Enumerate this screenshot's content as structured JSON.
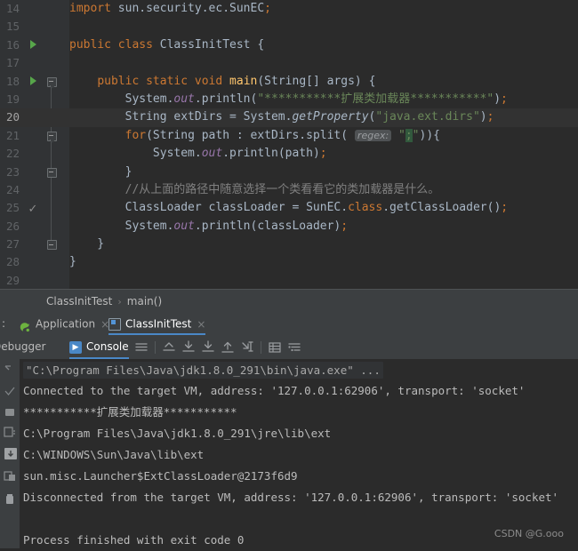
{
  "editor": {
    "name": "code-editor",
    "lines": [
      {
        "n": "14",
        "marker": "",
        "fold": "",
        "cur": false
      },
      {
        "n": "15",
        "marker": "",
        "fold": "",
        "cur": false
      },
      {
        "n": "16",
        "marker": "run",
        "fold": "",
        "cur": false
      },
      {
        "n": "17",
        "marker": "",
        "fold": "",
        "cur": false
      },
      {
        "n": "18",
        "marker": "run",
        "fold": "minus",
        "cur": false
      },
      {
        "n": "19",
        "marker": "",
        "fold": "",
        "cur": false
      },
      {
        "n": "20",
        "marker": "",
        "fold": "",
        "cur": true
      },
      {
        "n": "21",
        "marker": "",
        "fold": "minus",
        "cur": false
      },
      {
        "n": "22",
        "marker": "",
        "fold": "",
        "cur": false
      },
      {
        "n": "23",
        "marker": "",
        "fold": "end",
        "cur": false
      },
      {
        "n": "24",
        "marker": "",
        "fold": "",
        "cur": false
      },
      {
        "n": "25",
        "marker": "check",
        "fold": "",
        "cur": false
      },
      {
        "n": "26",
        "marker": "",
        "fold": "",
        "cur": false
      },
      {
        "n": "27",
        "marker": "",
        "fold": "end",
        "cur": false
      },
      {
        "n": "28",
        "marker": "",
        "fold": "",
        "cur": false
      },
      {
        "n": "29",
        "marker": "",
        "fold": "",
        "cur": false
      }
    ],
    "code_text": [
      "import sun.security.ec.SunEC;",
      "",
      "public class ClassInitTest {",
      "",
      "    public static void main(String[] args) {",
      "        System.out.println(\"***********扩展类加载器***********\");",
      "        String extDirs = System.getProperty(\"java.ext.dirs\");",
      "        for(String path : extDirs.split( regex: \";\")){",
      "            System.out.println(path);",
      "        }",
      "        //从上面的路径中随意选择一个类看看它的类加载器是什么。",
      "        ClassLoader classLoader = SunEC.class.getClassLoader();",
      "        System.out.println(classLoader);",
      "    }",
      "}",
      ""
    ],
    "inlay_hint": "regex:"
  },
  "breadcrumb": {
    "name": "breadcrumb",
    "class_name": "ClassInitTest",
    "separator": "›",
    "method_name": "main()"
  },
  "run_window": {
    "prefix_label": ":",
    "tabs": [
      {
        "label": "Application",
        "icon": "spring-icon",
        "close": "×",
        "active": false
      },
      {
        "label": "ClassInitTest",
        "icon": "class-icon",
        "close": "×",
        "active": true
      }
    ],
    "panels": [
      {
        "label": "Debugger",
        "active": false
      },
      {
        "label": "Console",
        "active": true
      }
    ],
    "toolbar_icons": [
      "soft-wrap-icon",
      "divider",
      "export-up-icon",
      "scroll-down-icon",
      "print-down-icon",
      "scroll-up-icon",
      "scroll-to-end-icon",
      "divider",
      "grid-icon",
      "settings-list-icon"
    ],
    "side_icons": [
      "rerun-icon",
      "check-icon",
      "stop-icon",
      "trace-icon",
      "print-icon",
      "soft-wrap-side-icon",
      "trash-icon"
    ]
  },
  "console": {
    "name": "console-output",
    "lines": [
      {
        "text": "\"C:\\Program Files\\Java\\jdk1.8.0_291\\bin\\java.exe\" ...",
        "style": "folded"
      },
      {
        "text": "Connected to the target VM, address: '127.0.0.1:62906', transport: 'socket'",
        "style": "normal"
      },
      {
        "text": "***********扩展类加载器***********",
        "style": "normal"
      },
      {
        "text": "C:\\Program Files\\Java\\jdk1.8.0_291\\jre\\lib\\ext",
        "style": "normal"
      },
      {
        "text": "C:\\WINDOWS\\Sun\\Java\\lib\\ext",
        "style": "normal"
      },
      {
        "text": "sun.misc.Launcher$ExtClassLoader@2173f6d9",
        "style": "normal"
      },
      {
        "text": "Disconnected from the target VM, address: '127.0.0.1:62906', transport: 'socket'",
        "style": "normal"
      },
      {
        "text": "",
        "style": "normal"
      },
      {
        "text": "Process finished with exit code 0",
        "style": "normal"
      }
    ]
  },
  "watermark": {
    "text": "CSDN @G.ooo"
  },
  "colors": {
    "editor_bg": "#2b2b2b",
    "gutter_bg": "#313335",
    "panel_bg": "#3c3f41",
    "current_line": "#323232",
    "accent": "#4a88c7",
    "keyword": "#cc7832",
    "string": "#6a8759",
    "field": "#9876aa",
    "comment": "#808080",
    "text": "#a9b7c6",
    "run_green": "#57a64a"
  }
}
